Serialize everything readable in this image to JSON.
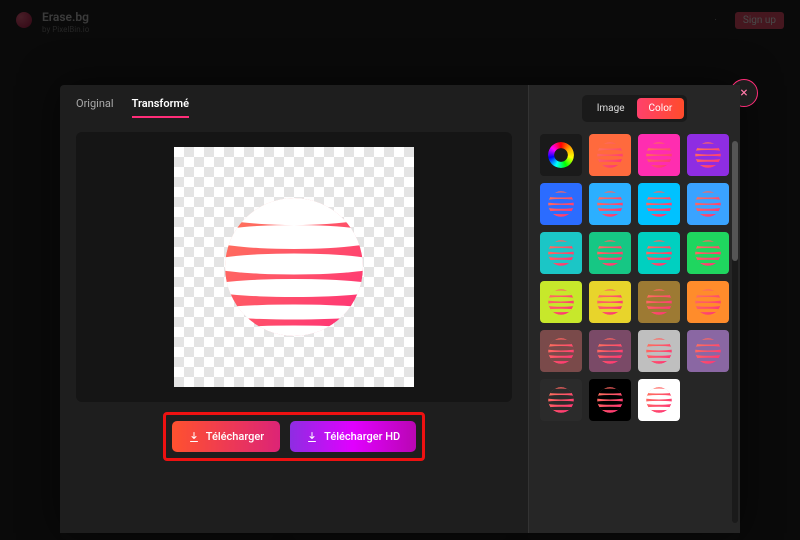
{
  "brand": {
    "name": "Erase.bg",
    "sub": "by PixelBin.io"
  },
  "header": {
    "signup": "Sign up"
  },
  "tabs": {
    "original": "Original",
    "transformed": "Transformé"
  },
  "buttons": {
    "download": "Télécharger",
    "download_hd": "Télécharger HD",
    "close": "×"
  },
  "mode": {
    "image": "Image",
    "color": "Color"
  },
  "swatches": [
    {
      "bg": "#ff6a3d",
      "sphere": "#ff4d6d"
    },
    {
      "bg": "#ff2db0",
      "sphere": "#ff4d6d"
    },
    {
      "bg": "#8e2de2",
      "sphere": "#ff4d6d"
    },
    {
      "bg": "#2b6cff",
      "sphere": "#ff4d6d"
    },
    {
      "bg": "#2bafff",
      "sphere": "#ff4d6d"
    },
    {
      "bg": "#00c2ff",
      "sphere": "#ff4d6d"
    },
    {
      "bg": "#3aa3ff",
      "sphere": "#ff4d6d"
    },
    {
      "bg": "#1bc6c6",
      "sphere": "#ff4d6d"
    },
    {
      "bg": "#16c784",
      "sphere": "#ff4d6d"
    },
    {
      "bg": "#00d0c0",
      "sphere": "#ff4d6d"
    },
    {
      "bg": "#1fd65f",
      "sphere": "#ff4d6d"
    },
    {
      "bg": "#c7e82b",
      "sphere": "#ff4d6d"
    },
    {
      "bg": "#e8d42b",
      "sphere": "#ff4d6d"
    },
    {
      "bg": "#9d7a33",
      "sphere": "#ff4d6d"
    },
    {
      "bg": "#ff8c2b",
      "sphere": "#ff4d6d"
    },
    {
      "bg": "#7a4a4a",
      "sphere": "#ff4d6d"
    },
    {
      "bg": "#7a4a67",
      "sphere": "#ff4d6d"
    },
    {
      "bg": "#bfbfbf",
      "sphere": "#ff4d6d"
    },
    {
      "bg": "#8a67a3",
      "sphere": "#ff4d6d"
    },
    {
      "bg": "#2b2b2b",
      "sphere": "#ff4d6d"
    },
    {
      "bg": "#000000",
      "sphere": "#ff4d6d"
    },
    {
      "bg": "#ffffff",
      "sphere": "#ff4d6d"
    }
  ]
}
